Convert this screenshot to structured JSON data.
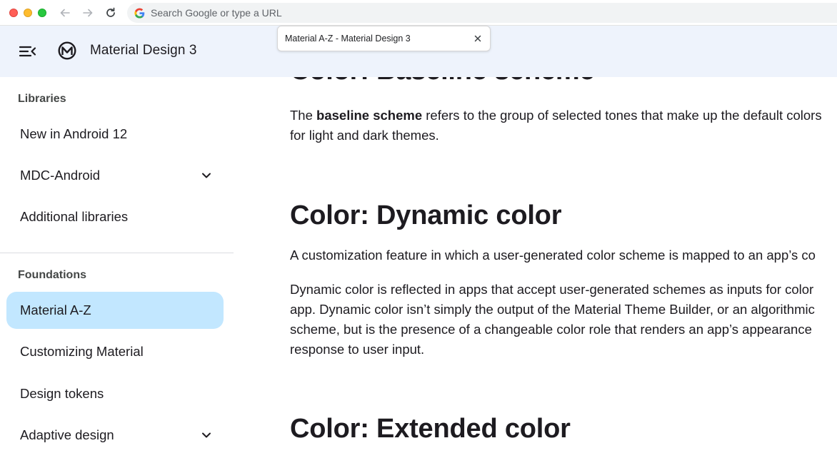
{
  "browser": {
    "omnibox_placeholder": "Search Google or type a URL",
    "tab_title": "Material A-Z - Material Design 3"
  },
  "header": {
    "site_title": "Material Design 3"
  },
  "sidebar": {
    "sections": [
      {
        "label": "Libraries",
        "items": [
          {
            "label": "New in Android 12",
            "expandable": false
          },
          {
            "label": "MDC-Android",
            "expandable": true
          },
          {
            "label": "Additional libraries",
            "expandable": false
          }
        ]
      },
      {
        "label": "Foundations",
        "items": [
          {
            "label": "Material A-Z",
            "expandable": false,
            "active": true
          },
          {
            "label": "Customizing Material",
            "expandable": false
          },
          {
            "label": "Design tokens",
            "expandable": false
          },
          {
            "label": "Adaptive design",
            "expandable": true
          }
        ]
      }
    ]
  },
  "main": {
    "baseline": {
      "heading": "Color: Baseline scheme",
      "p1_pre": "The ",
      "p1_bold": "baseline scheme",
      "p1_post": " refers to the group of selected tones that make up the default colors",
      "p1_line2": "for light and dark themes."
    },
    "dynamic": {
      "heading": "Color: Dynamic color",
      "p1": "A customization feature in which a user-generated color scheme is mapped to an app’s co",
      "p2_lines": [
        "Dynamic color is reflected in apps that accept user-generated schemes as inputs for color",
        "app. Dynamic color isn’t simply the output of the Material Theme Builder, or an algorithmic",
        "scheme, but is the presence of a changeable color role that renders an app’s appearance",
        "response to user input."
      ]
    },
    "extended": {
      "heading": "Color: Extended color"
    }
  },
  "colors": {
    "header_bg": "#eef3fc",
    "active_nav_bg": "#c2e7ff",
    "text_primary": "#1d1b20"
  }
}
